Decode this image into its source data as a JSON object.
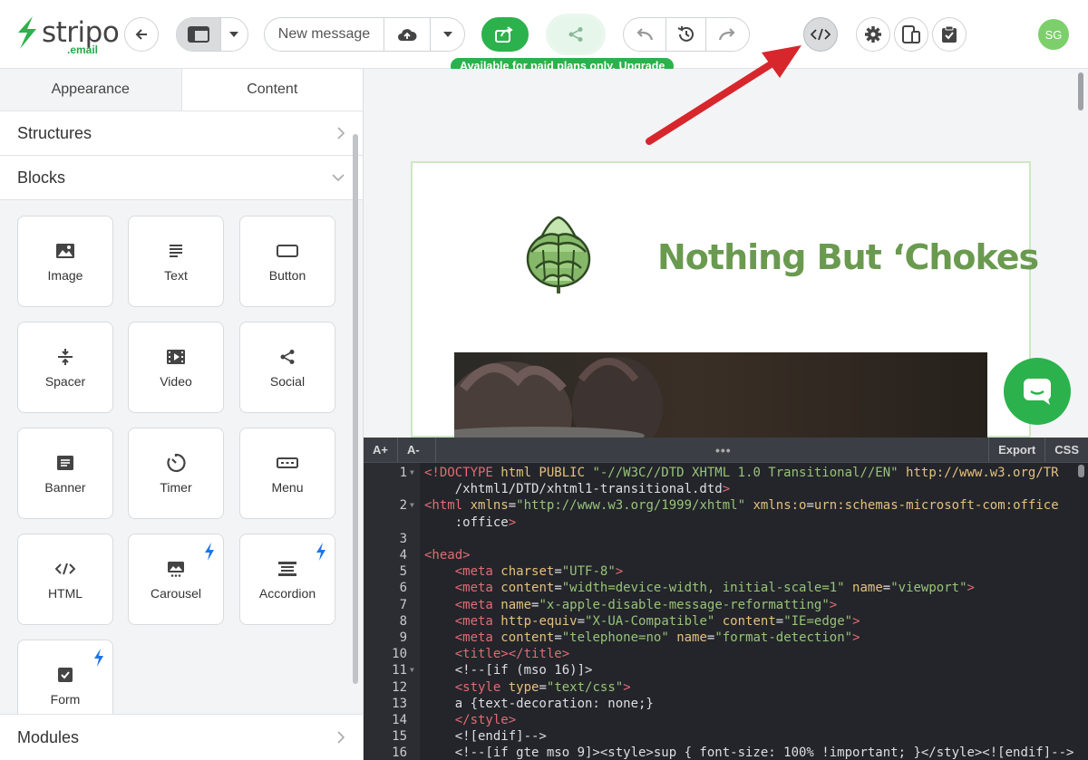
{
  "toolbar": {
    "logo_word": "stripo",
    "logo_sub": ".email",
    "message_name": "New message",
    "paid_note": "Available for paid plans only.",
    "paid_link": "Upgrade",
    "avatar": "SG"
  },
  "panel": {
    "tabs": [
      {
        "label": "Appearance"
      },
      {
        "label": "Content"
      }
    ],
    "structures_label": "Structures",
    "blocks_label": "Blocks",
    "modules_label": "Modules",
    "blocks": [
      {
        "label": "Image",
        "icon": "image-icon",
        "pro": false
      },
      {
        "label": "Text",
        "icon": "text-icon",
        "pro": false
      },
      {
        "label": "Button",
        "icon": "button-icon",
        "pro": false
      },
      {
        "label": "Spacer",
        "icon": "spacer-icon",
        "pro": false
      },
      {
        "label": "Video",
        "icon": "video-icon",
        "pro": false
      },
      {
        "label": "Social",
        "icon": "share-icon",
        "pro": false
      },
      {
        "label": "Banner",
        "icon": "banner-icon",
        "pro": false
      },
      {
        "label": "Timer",
        "icon": "timer-icon",
        "pro": false
      },
      {
        "label": "Menu",
        "icon": "menu-icon",
        "pro": false
      },
      {
        "label": "HTML",
        "icon": "code-icon",
        "pro": false
      },
      {
        "label": "Carousel",
        "icon": "carousel-icon",
        "pro": true
      },
      {
        "label": "Accordion",
        "icon": "accordion-icon",
        "pro": true
      },
      {
        "label": "Form",
        "icon": "form-icon",
        "pro": true
      }
    ]
  },
  "email": {
    "brand_title": "Nothing But ‘Chokes"
  },
  "editor": {
    "font_up": "A+",
    "font_down": "A-",
    "export": "Export",
    "css": "CSS",
    "line_numbers": [
      "1",
      "",
      "2",
      "",
      "3",
      "4",
      "5",
      "6",
      "7",
      "8",
      "9",
      "10",
      "11",
      "12",
      "13",
      "14",
      "15",
      "16"
    ],
    "lines": [
      "<!DOCTYPE html PUBLIC \"-//W3C//DTD XHTML 1.0 Transitional//EN\" \"http://www.w3.org/TR",
      "    /xhtml1/DTD/xhtml1-transitional.dtd\">",
      "<html xmlns=\"http://www.w3.org/1999/xhtml\" xmlns:o=\"urn:schemas-microsoft-com:office",
      "    :office\">",
      "",
      "<head>",
      "    <meta charset=\"UTF-8\">",
      "    <meta content=\"width=device-width, initial-scale=1\" name=\"viewport\">",
      "    <meta name=\"x-apple-disable-message-reformatting\">",
      "    <meta http-equiv=\"X-UA-Compatible\" content=\"IE=edge\">",
      "    <meta content=\"telephone=no\" name=\"format-detection\">",
      "    <title></title>",
      "    <!--[if (mso 16)]>",
      "    <style type=\"text/css\">",
      "    a {text-decoration: none;}",
      "    </style>",
      "    <![endif]-->",
      "    <!--[if gte mso 9]><style>sup { font-size: 100% !important; }</style><![endif]-->"
    ]
  },
  "colors": {
    "accent": "#2bb24c",
    "brand_green": "#6a9a4f",
    "arrow_red": "#d7262c"
  }
}
